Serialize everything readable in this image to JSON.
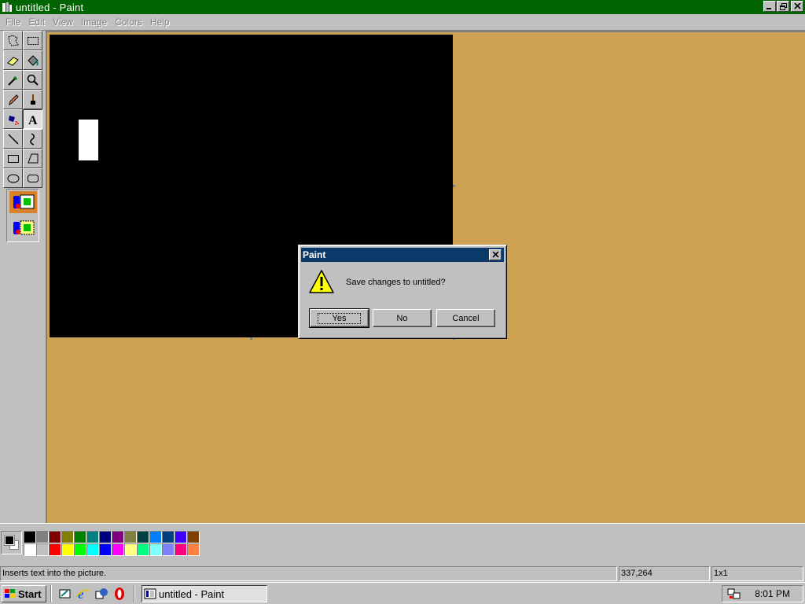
{
  "window": {
    "title": "untitled - Paint"
  },
  "menubar": {
    "items": [
      "File",
      "Edit",
      "View",
      "Image",
      "Colors",
      "Help"
    ]
  },
  "toolbox": {
    "tools": [
      "free-form-select-icon",
      "select-icon",
      "eraser-icon",
      "fill-bucket-icon",
      "pick-color-icon",
      "magnifier-icon",
      "pencil-icon",
      "brush-icon",
      "airbrush-icon",
      "text-icon",
      "line-icon",
      "curve-icon",
      "rectangle-icon",
      "polygon-icon",
      "ellipse-icon",
      "rounded-rectangle-icon"
    ],
    "selected_tool": "text-icon"
  },
  "palette": {
    "foreground": "#000000",
    "background": "#ffffff",
    "colors": [
      "#000000",
      "#808080",
      "#800000",
      "#808000",
      "#008000",
      "#008080",
      "#000080",
      "#800080",
      "#808040",
      "#004040",
      "#0080ff",
      "#004080",
      "#4000ff",
      "#804000",
      "#ffffff",
      "#c0c0c0",
      "#ff0000",
      "#ffff00",
      "#00ff00",
      "#00ffff",
      "#0000ff",
      "#ff00ff",
      "#ffff80",
      "#00ff80",
      "#80ffff",
      "#8080ff",
      "#ff0080",
      "#ff8040"
    ]
  },
  "statusbar": {
    "help_text": "Inserts text into the picture.",
    "coords": "337,264",
    "size": "1x1"
  },
  "dialog": {
    "title": "Paint",
    "message": "Save changes to untitled?",
    "buttons": {
      "yes": "Yes",
      "no": "No",
      "cancel": "Cancel"
    }
  },
  "taskbar": {
    "start_label": "Start",
    "task_label": "untitled - Paint",
    "clock": "8:01 PM"
  },
  "colors": {
    "titlebar": "#006400",
    "dialog_titlebar": "#0a3a6a",
    "workspace": "#cca252",
    "face": "#c0c0c0"
  }
}
